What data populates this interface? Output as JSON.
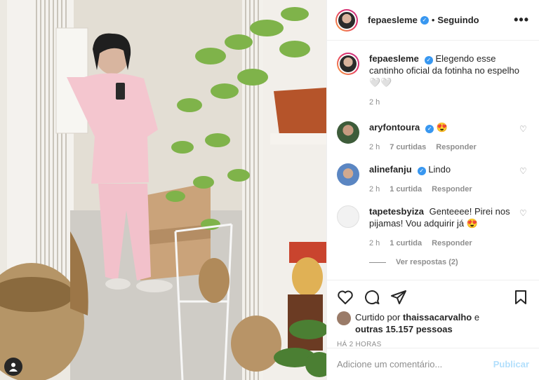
{
  "post": {
    "username": "fepaesleme",
    "follow_status": "Seguindo",
    "more_label": "•••"
  },
  "caption": {
    "username": "fepaesleme",
    "text": "Elegendo esse cantinho oficial da fotinha no espelho 🤍🤍",
    "time": "2 h"
  },
  "comments": [
    {
      "username": "aryfontoura",
      "text": "😍",
      "time": "2 h",
      "likes": "7 curtidas",
      "reply": "Responder",
      "verified": true
    },
    {
      "username": "alinefanju",
      "text": "Lindo",
      "time": "2 h",
      "likes": "1 curtida",
      "reply": "Responder",
      "verified": true
    },
    {
      "username": "tapetesbyiza",
      "text": "Genteeee! Pirei nos pijamas! Vou adquirir já 😍",
      "time": "2 h",
      "likes": "1 curtida",
      "reply": "Responder",
      "verified": false
    }
  ],
  "view_replies": "Ver respostas (2)",
  "likes": {
    "prefix": "Curtido por",
    "user": "thaissacarvalho",
    "mid": "e",
    "others": "outras 15.157 pessoas"
  },
  "post_time": "HÁ 2 HORAS",
  "add_comment": {
    "placeholder": "Adicione um comentário...",
    "publish": "Publicar"
  },
  "colors": {
    "verified": "#3897f0",
    "publish_disabled": "#b2dffc",
    "muted": "#8e8e8e"
  }
}
